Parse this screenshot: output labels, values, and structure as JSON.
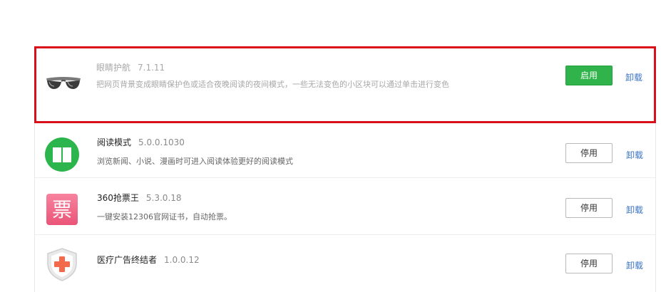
{
  "extensions": [
    {
      "name": "眼睛护航",
      "version": "7.1.11",
      "description": "把网页背景变成眼睛保护色或适合夜晚阅读的夜间模式，一些无法变色的小区块可以通过单击进行变色",
      "action_label": "启用",
      "uninstall_label": "卸载",
      "icon": "sunglasses-icon",
      "state": "disabled",
      "highlighted": true
    },
    {
      "name": "阅读模式",
      "version": "5.0.0.1030",
      "description": "浏览新闻、小说、漫画时可进入阅读体验更好的阅读模式",
      "action_label": "停用",
      "uninstall_label": "卸载",
      "icon": "book-icon",
      "state": "enabled"
    },
    {
      "name": "360抢票王",
      "version": "5.3.0.18",
      "description": "一键安装12306官网证书，自动抢票。",
      "action_label": "停用",
      "uninstall_label": "卸载",
      "icon": "ticket-icon",
      "icon_glyph": "票",
      "state": "enabled"
    },
    {
      "name": "医疗广告终结者",
      "version": "1.0.0.12",
      "description": "",
      "action_label": "停用",
      "uninstall_label": "卸载",
      "icon": "medical-shield-icon",
      "state": "enabled"
    }
  ],
  "colors": {
    "highlight_border": "#d9101a",
    "enable_button": "#2fb34a",
    "link": "#3b73c4",
    "book_icon_bg": "#2cb54c",
    "ticket_icon_bg": "#f06b8a",
    "medical_cross": "#f26a4b"
  }
}
